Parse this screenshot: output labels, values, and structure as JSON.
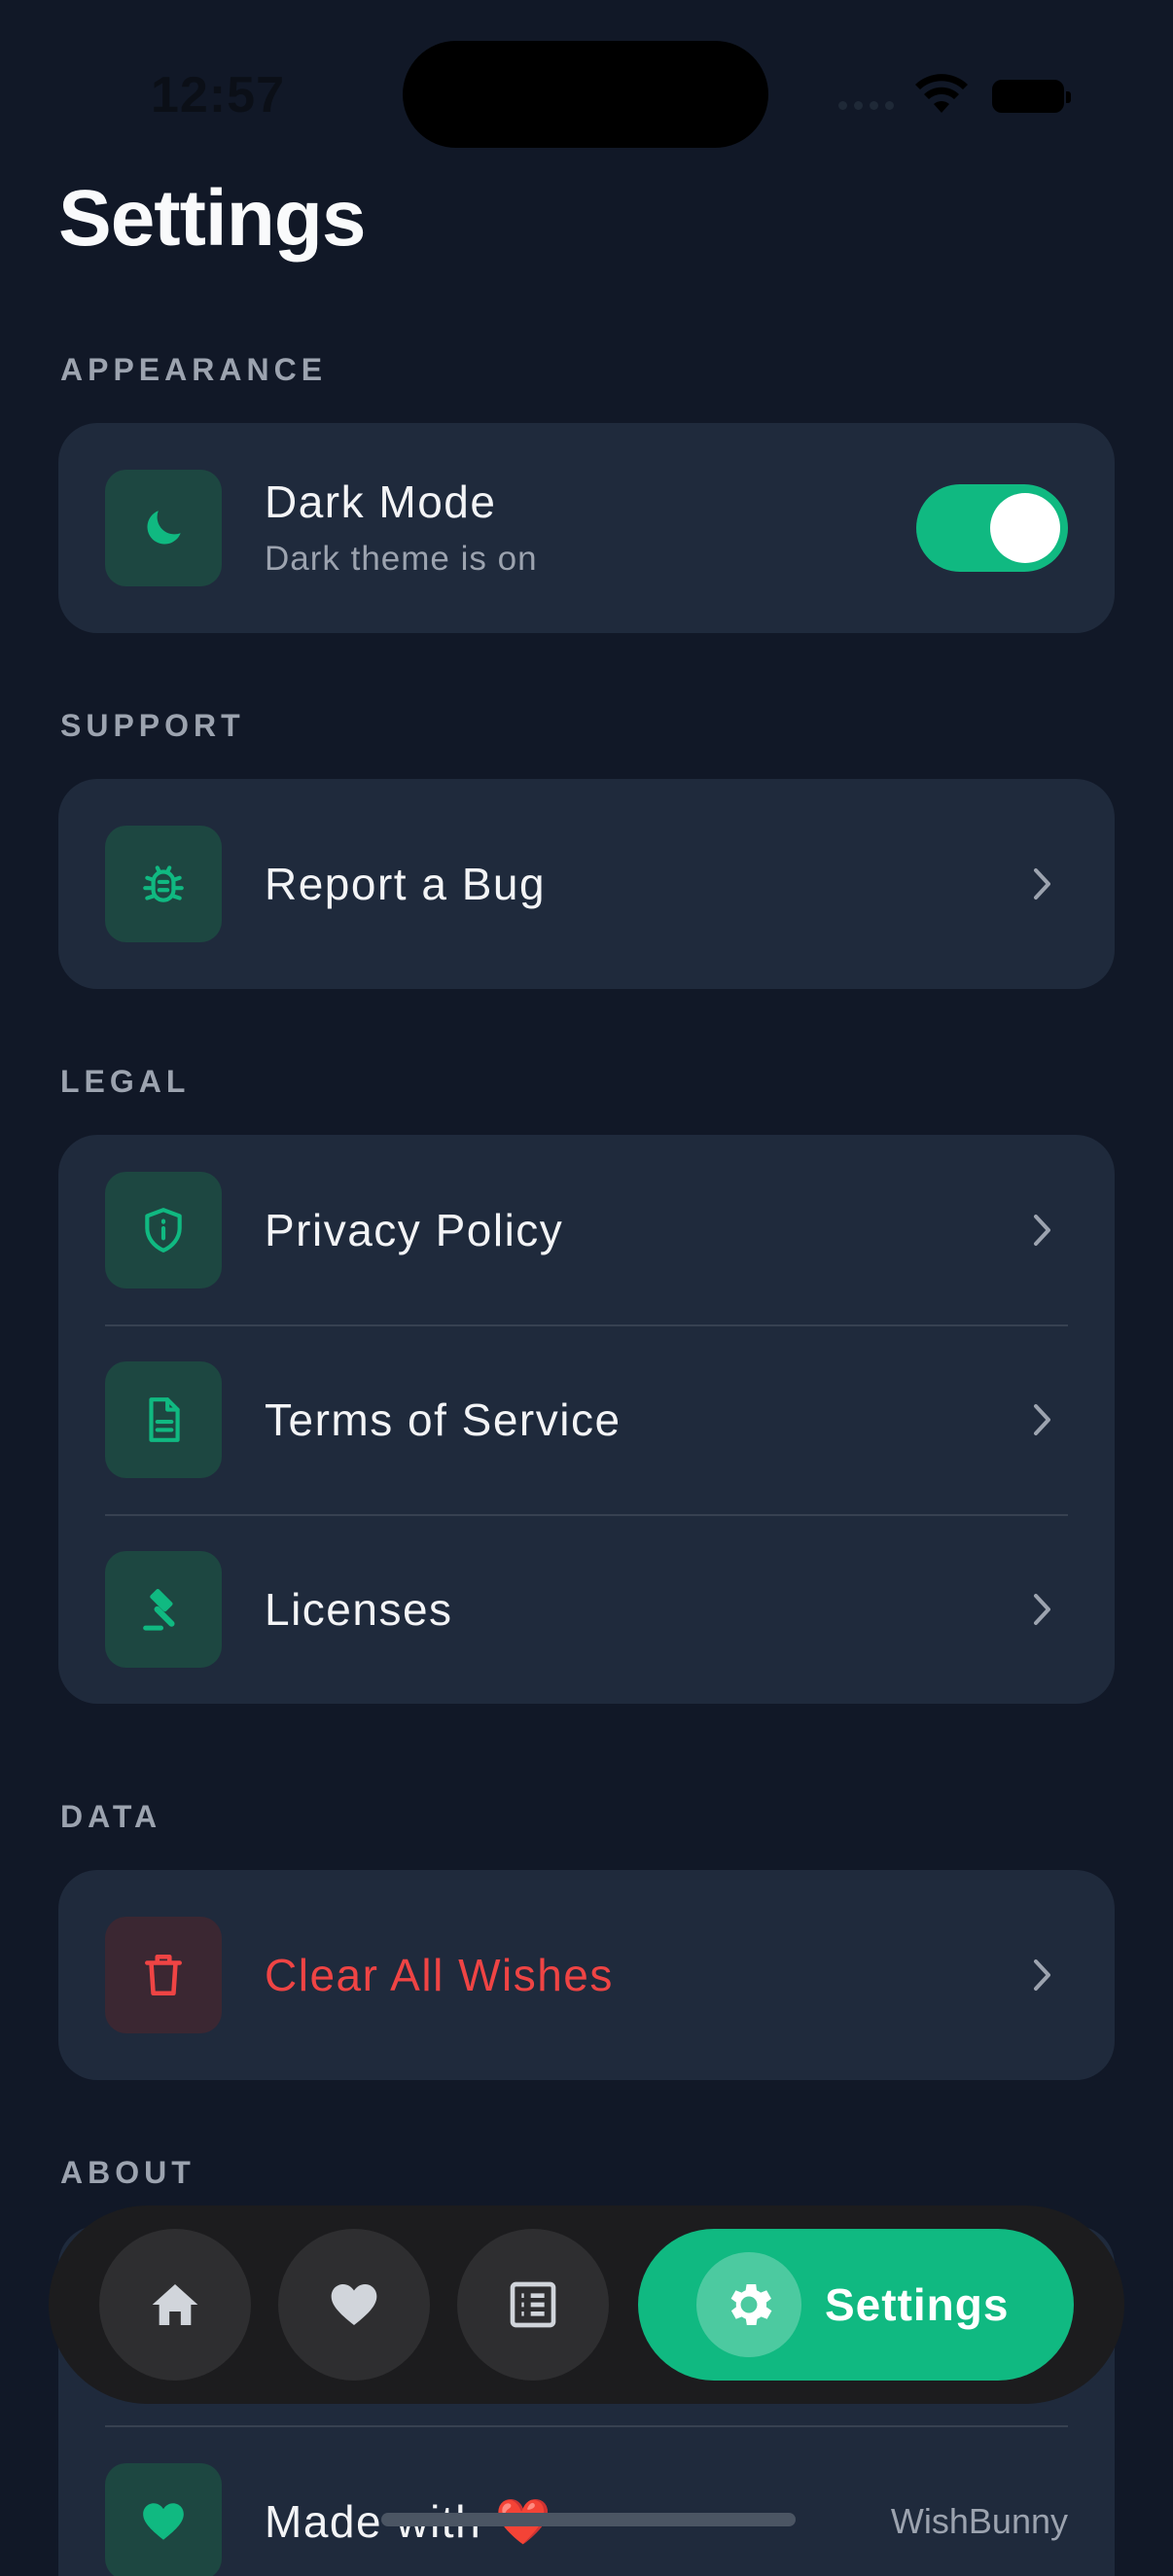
{
  "status_bar": {
    "time": "12:57"
  },
  "page": {
    "title": "Settings"
  },
  "sections": {
    "appearance": {
      "label": "APPEARANCE"
    },
    "support": {
      "label": "SUPPORT"
    },
    "legal": {
      "label": "LEGAL"
    },
    "data": {
      "label": "DATA"
    },
    "about": {
      "label": "ABOUT"
    }
  },
  "dark_mode": {
    "label": "Dark Mode",
    "subtitle": "Dark theme is on",
    "enabled": true,
    "icon": "moon-icon"
  },
  "support_items": [
    {
      "label": "Report a Bug",
      "icon": "bug-icon"
    }
  ],
  "legal_items": [
    {
      "label": "Privacy Policy",
      "icon": "shield-info-icon"
    },
    {
      "label": "Terms of Service",
      "icon": "document-icon"
    },
    {
      "label": "Licenses",
      "icon": "gavel-icon"
    }
  ],
  "data_items": [
    {
      "label": "Clear All Wishes",
      "icon": "trash-icon",
      "color": "#ef4444"
    }
  ],
  "about_items": [
    {
      "label": "Made with ❤️",
      "value": "WishBunny",
      "icon": "heart-icon"
    }
  ],
  "tabbar": {
    "tabs": [
      {
        "icon": "home-icon"
      },
      {
        "icon": "heart-icon"
      },
      {
        "icon": "list-icon"
      }
    ],
    "active": {
      "label": "Settings",
      "icon": "gear-icon"
    }
  },
  "colors": {
    "accent": "#10b981",
    "background": "#111827",
    "card": "#1f2a3c",
    "danger": "#ef4444"
  }
}
